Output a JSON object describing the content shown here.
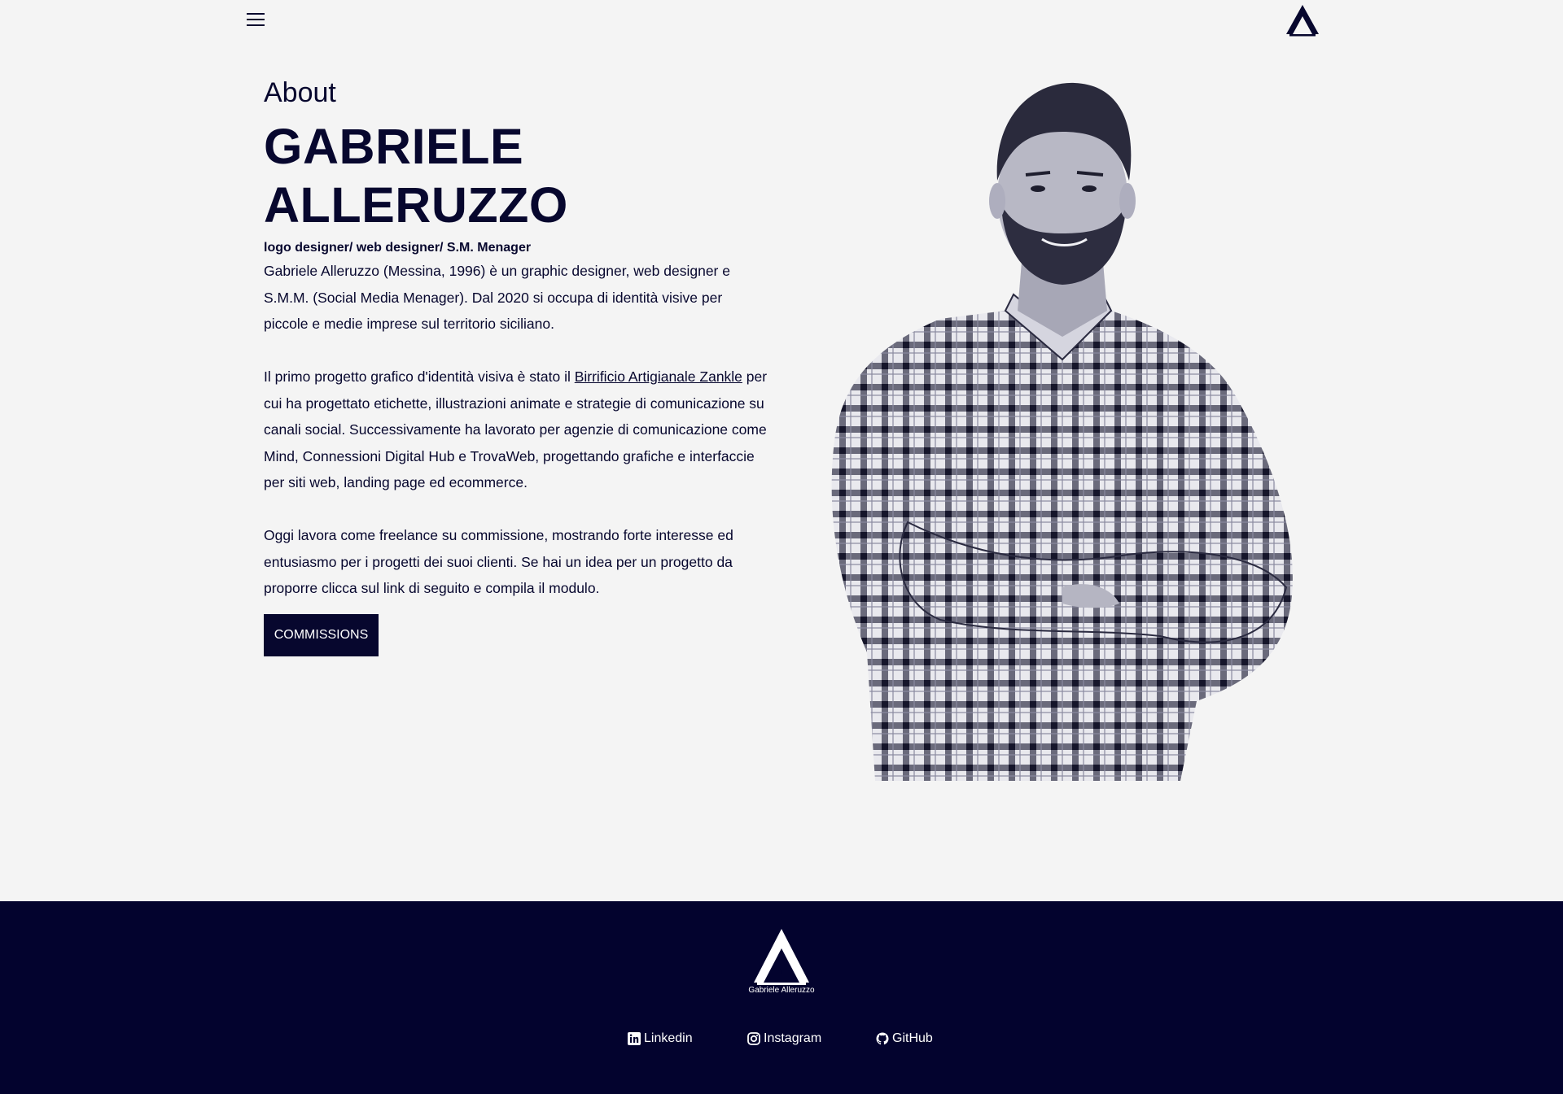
{
  "header": {
    "menu_icon": "hamburger-menu-icon",
    "logo_icon": "ga-logo-icon"
  },
  "about": {
    "section_label": "About",
    "first_name": "GABRIELE",
    "last_name": "ALLERUZZO",
    "roles": "logo designer/ web designer/ S.M. Menager",
    "paragraph1": "Gabriele Alleruzzo (Messina, 1996) è un graphic designer, web designer e S.M.M. (Social Media Menager). Dal 2020 si occupa di identità visive per piccole e medie imprese sul territorio siciliano.",
    "paragraph2_before_link": "Il primo progetto grafico d'identità visiva è stato il ",
    "paragraph2_link": "Birrificio Artigianale Zankle",
    "paragraph2_after_link": " per cui ha progettato etichette, illustrazioni animate e strategie di comunicazione su canali social. Successivamente ha lavorato per agenzie di comunicazione come Mind, Connessioni Digital Hub e TrovaWeb, progettando grafiche e interfaccie per siti web, landing page ed ecommerce.",
    "paragraph3": "Oggi lavora come freelance su commissione, mostrando forte interesse ed entusiasmo per i progetti dei suoi clienti. Se hai un idea per un progetto da proporre clicca sul link di seguito e compila il modulo.",
    "button_label": "COMMISSIONS"
  },
  "footer": {
    "brand_name": "Gabriele Alleruzzo",
    "links": [
      {
        "label": "Linkedin",
        "icon": "linkedin-icon"
      },
      {
        "label": "Instagram",
        "icon": "instagram-icon"
      },
      {
        "label": "GitHub",
        "icon": "github-icon"
      }
    ]
  },
  "colors": {
    "background": "#f4f4f4",
    "primary": "#07072e",
    "footer_background": "#03032e",
    "footer_text": "#ffffff"
  }
}
